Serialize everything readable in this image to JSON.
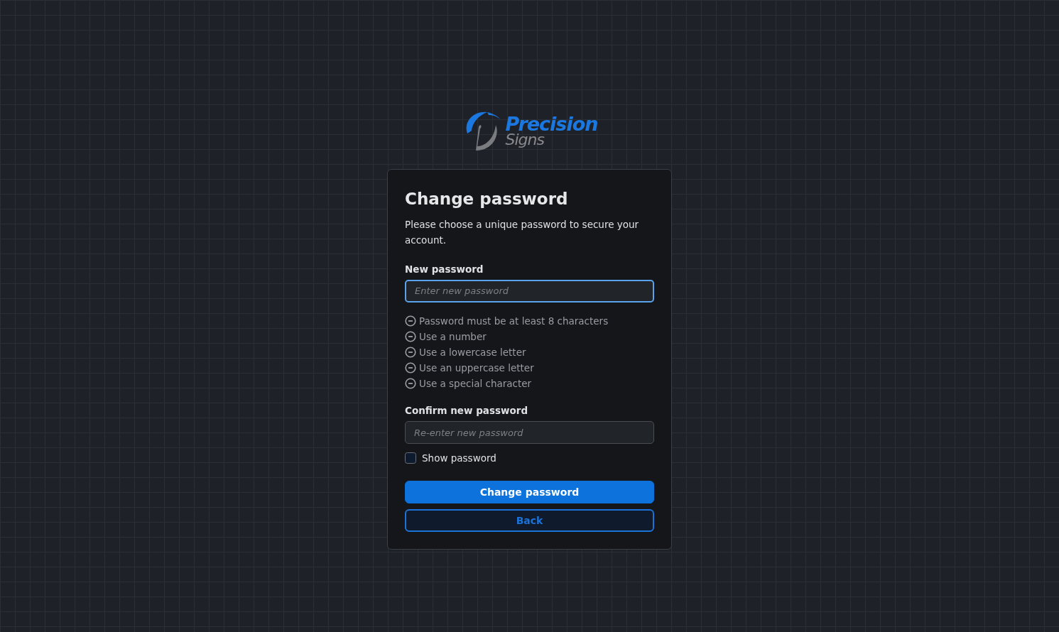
{
  "logo": {
    "line_1": "Precision",
    "line_2": "Signs"
  },
  "card": {
    "title": "Change password",
    "subtitle": "Please choose a unique password to secure your account.",
    "new_password": {
      "label": "New password",
      "placeholder": "Enter new password",
      "focused": true
    },
    "requirements": [
      {
        "text": "Password must be at least 8 characters",
        "met": false
      },
      {
        "text": "Use a number",
        "met": false
      },
      {
        "text": "Use a lowercase letter",
        "met": false
      },
      {
        "text": "Use an uppercase letter",
        "met": false
      },
      {
        "text": "Use a special character",
        "met": false
      }
    ],
    "confirm_password": {
      "label": "Confirm new password",
      "placeholder": "Re-enter new password",
      "focused": false
    },
    "show_password": {
      "label": "Show password",
      "checked": false
    },
    "buttons": [
      {
        "label": "Change password",
        "kind": "primary"
      },
      {
        "label": "Back",
        "kind": "outline"
      }
    ]
  }
}
